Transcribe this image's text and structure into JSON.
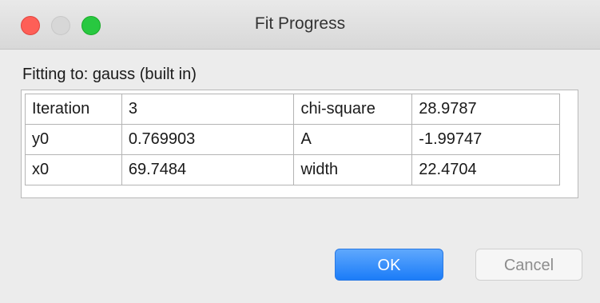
{
  "window": {
    "title": "Fit Progress"
  },
  "fitting_label": "Fitting to: gauss (built in)",
  "table": {
    "rows": [
      {
        "name1": "Iteration",
        "value1": "3",
        "name2": "chi-square",
        "value2": "28.9787"
      },
      {
        "name1": "y0",
        "value1": "0.769903",
        "name2": "A",
        "value2": "-1.99747"
      },
      {
        "name1": "x0",
        "value1": "69.7484",
        "name2": "width",
        "value2": "22.4704"
      }
    ]
  },
  "buttons": {
    "ok_label": "OK",
    "cancel_label": "Cancel"
  },
  "colors": {
    "close": "#fe5f57",
    "minimize": "#d7d7d7",
    "zoom": "#28c840",
    "default_button": "#1b7cf8"
  }
}
